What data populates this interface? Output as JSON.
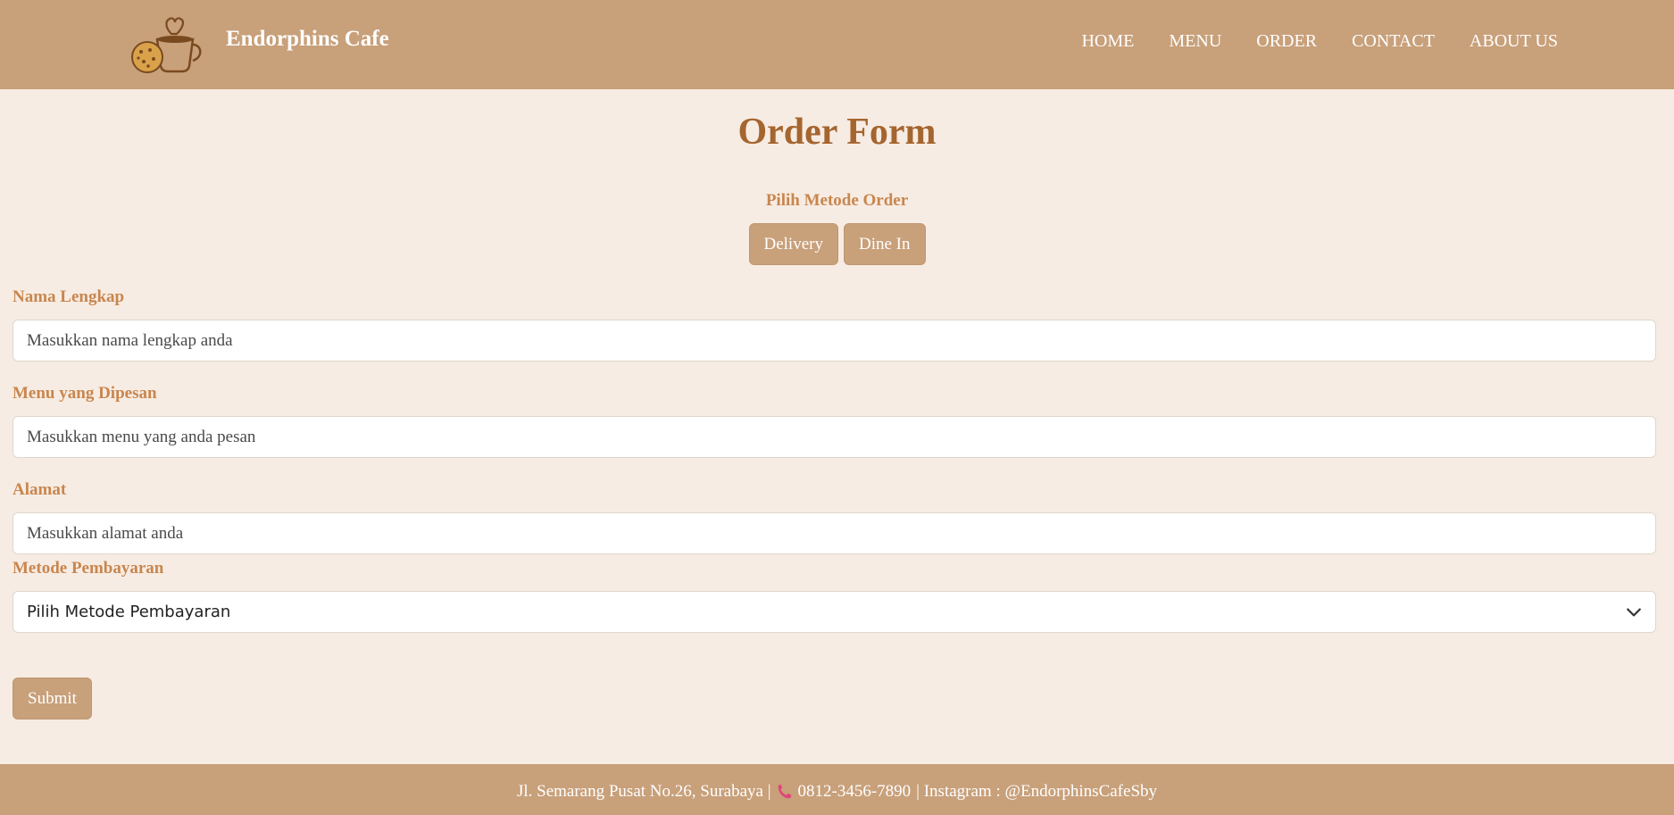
{
  "brand": {
    "name": "Endorphins Cafe",
    "logo_icon": "coffee-cookie-logo-icon"
  },
  "nav": {
    "items": [
      "HOME",
      "MENU",
      "ORDER",
      "CONTACT",
      "ABOUT US"
    ]
  },
  "page": {
    "title": "Order Form"
  },
  "order_method": {
    "label": "Pilih Metode Order",
    "options": [
      "Delivery",
      "Dine In"
    ]
  },
  "form": {
    "name": {
      "label": "Nama Lengkap",
      "placeholder": "Masukkan nama lengkap anda",
      "value": ""
    },
    "menu": {
      "label": "Menu yang Dipesan",
      "placeholder": "Masukkan menu yang anda pesan",
      "value": ""
    },
    "address": {
      "label": "Alamat",
      "placeholder": "Masukkan alamat anda",
      "value": ""
    },
    "payment": {
      "label": "Metode Pembayaran",
      "selected": "Pilih Metode Pembayaran"
    },
    "submit_label": "Submit"
  },
  "footer": {
    "address": "Jl. Semarang Pusat No.26, Surabaya |",
    "phone": "0812-3456-7890",
    "instagram": "| Instagram : @EndorphinsCafeSby",
    "phone_icon": "phone-icon"
  },
  "colors": {
    "header_bg": "#c8a07a",
    "page_bg": "#f7ece3",
    "title": "#a5652f",
    "label": "#c8864e"
  }
}
